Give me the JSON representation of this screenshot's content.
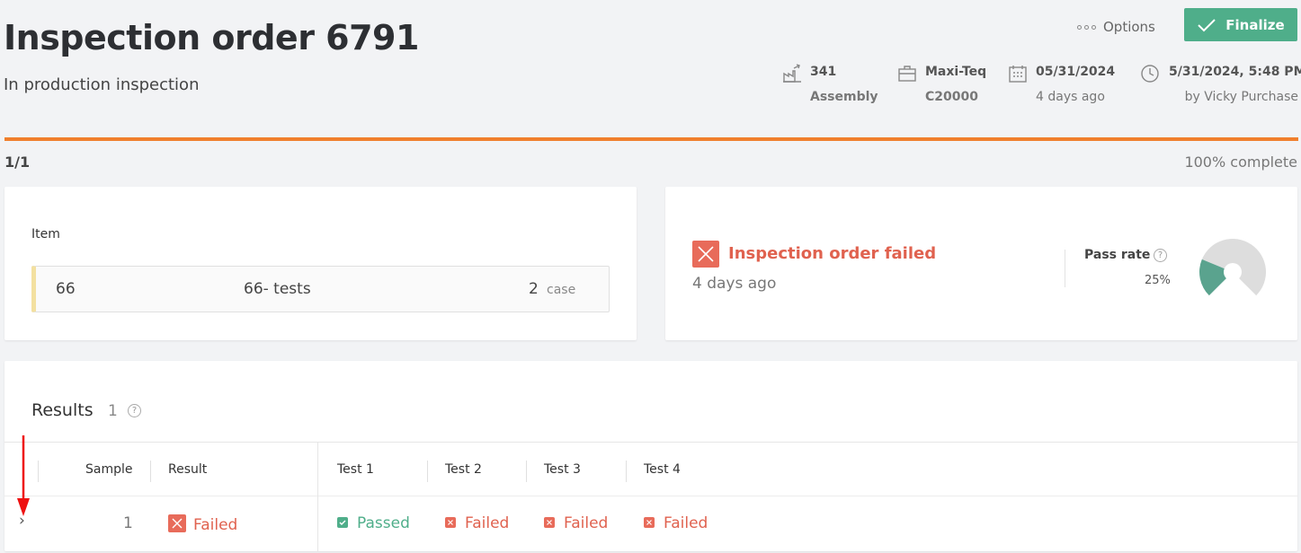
{
  "header": {
    "title": "Inspection order 6791",
    "subtitle": "In production inspection",
    "options_label": "Options",
    "finalize_label": "Finalize"
  },
  "meta": {
    "workcenter": {
      "icon": "factory-icon",
      "line1": "341",
      "line2": "Assembly"
    },
    "supplier": {
      "icon": "briefcase-icon",
      "line1": "Maxi-Teq",
      "line2": "C20000"
    },
    "date": {
      "icon": "calendar-icon",
      "line1": "05/31/2024",
      "line2": "4 days ago"
    },
    "created": {
      "icon": "clock-icon",
      "line1": "5/31/2024, 5:48 PM",
      "line2": "by Vicky Purchase"
    }
  },
  "progress": {
    "count": "1/1",
    "label": "100% complete",
    "percent": 100,
    "color": "#f07f2d"
  },
  "item_card": {
    "label": "Item",
    "code": "66",
    "name": "66- tests",
    "quantity": "2",
    "unit": "case"
  },
  "status_card": {
    "title": "Inspection order failed",
    "time": "4 days ago",
    "pass_rate_label": "Pass rate",
    "pass_rate_value": "25%",
    "pass_rate_fraction": 0.25,
    "pass_color": "#5aa38e",
    "fail_color": "#e86b5a"
  },
  "results": {
    "title": "Results",
    "count": "1",
    "columns": [
      "Sample",
      "Result",
      "Test 1",
      "Test 2",
      "Test 3",
      "Test 4"
    ],
    "rows": [
      {
        "sample": "1",
        "result": "Failed",
        "tests": [
          "Passed",
          "Failed",
          "Failed",
          "Failed"
        ]
      }
    ]
  }
}
